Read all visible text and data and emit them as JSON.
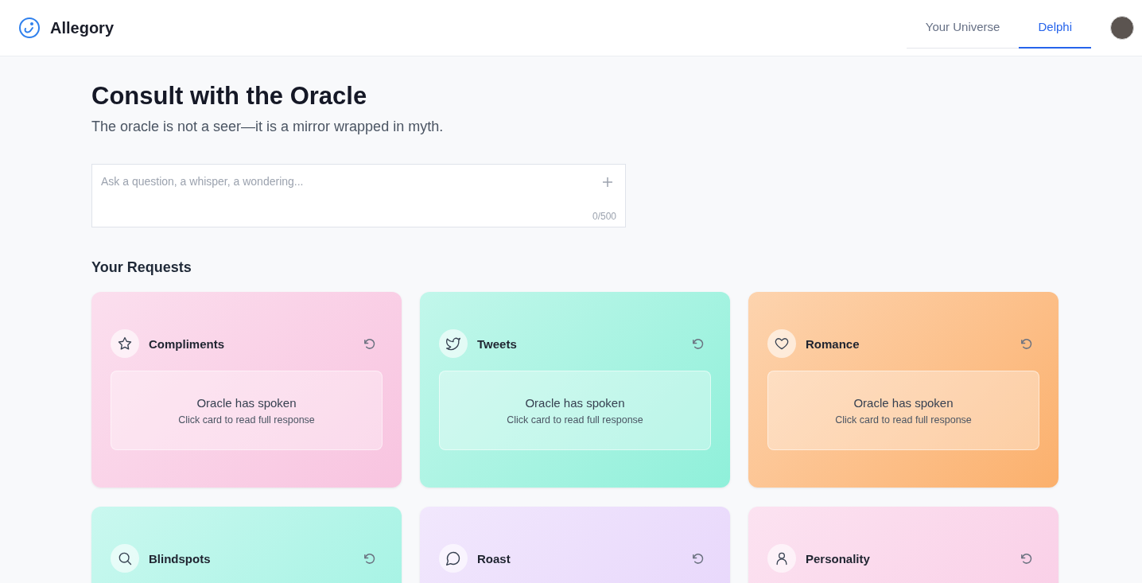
{
  "brand": {
    "name": "Allegory"
  },
  "tabs": [
    {
      "label": "Your Universe",
      "selected": false
    },
    {
      "label": "Delphi",
      "selected": true
    }
  ],
  "page": {
    "title": "Consult with the Oracle",
    "subtitle": "The oracle is not a seer—it is a mirror wrapped in myth."
  },
  "question": {
    "placeholder": "Ask a question, a whisper, a wondering...",
    "counter": "0/500"
  },
  "requests": {
    "heading": "Your Requests",
    "cards": [
      {
        "kind": "star",
        "title": "Compliments",
        "color": "#f8c4e0",
        "response": {
          "title": "Oracle has spoken",
          "hint": "Click card to read full response"
        }
      },
      {
        "kind": "bird",
        "title": "Tweets",
        "color": "#8ff0da",
        "response": {
          "title": "Oracle has spoken",
          "hint": "Click card to read full response"
        }
      },
      {
        "kind": "heart",
        "title": "Romance",
        "color": "#fbb06c",
        "response": {
          "title": "Oracle has spoken",
          "hint": "Click card to read full response"
        }
      },
      {
        "kind": "search",
        "title": "Blindspots",
        "color": "#9df2e2"
      },
      {
        "kind": "chat",
        "title": "Roast",
        "color": "#e6d4fb"
      },
      {
        "kind": "person",
        "title": "Personality",
        "color": "#f9cbe5"
      }
    ]
  }
}
